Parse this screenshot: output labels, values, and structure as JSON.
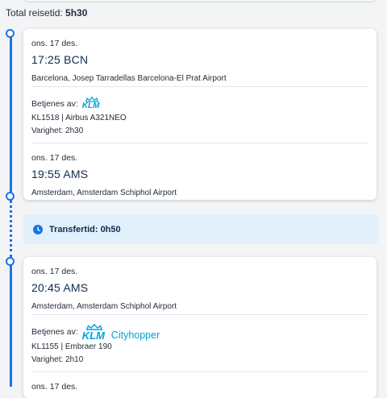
{
  "summary": {
    "total_label": "Total reisetid:",
    "total_value": "5h30"
  },
  "legs": [
    {
      "departure": {
        "date": "ons. 17 des.",
        "time": "17:25 BCN",
        "airport": "Barcelona, Josep Tarradellas Barcelona-El Prat Airport"
      },
      "operator": {
        "label": "Betjenes av:",
        "logo_text": "KLM",
        "logo_suffix": ""
      },
      "flight": "KL1518 | Airbus A321NEO",
      "duration": "Varighet: 2h30",
      "arrival": {
        "date": "ons. 17 des.",
        "time": "19:55 AMS",
        "airport": "Amsterdam, Amsterdam Schiphol Airport"
      }
    },
    {
      "departure": {
        "date": "ons. 17 des.",
        "time": "20:45 AMS",
        "airport": "Amsterdam, Amsterdam Schiphol Airport"
      },
      "operator": {
        "label": "Betjenes av:",
        "logo_text": "KLM",
        "logo_suffix": "Cityhopper"
      },
      "flight": "KL1155 | Embraer 190",
      "duration": "Varighet: 2h10",
      "arrival": {
        "date": "ons. 17 des."
      }
    }
  ],
  "transfer": {
    "label": "Transfertid: 0h50",
    "icon": "clock-icon"
  },
  "colors": {
    "accent": "#1a73e8",
    "klm_blue": "#00a1de",
    "transfer_bg": "#e1f0fb"
  }
}
